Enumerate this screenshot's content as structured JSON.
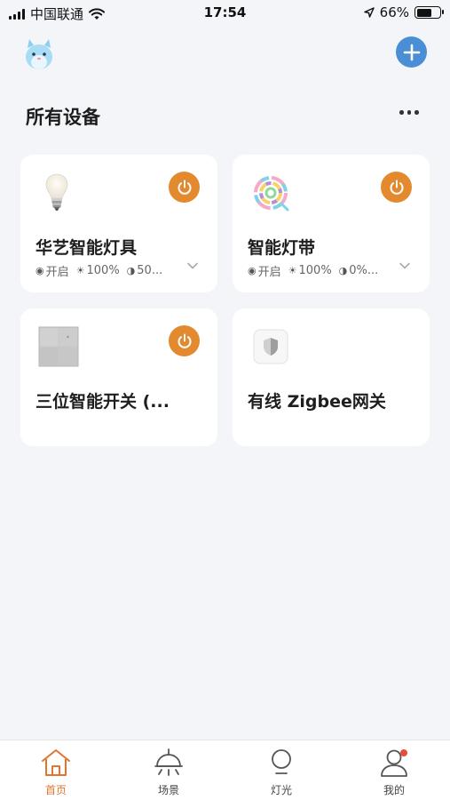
{
  "status_bar": {
    "carrier": "中国联通",
    "time": "17:54",
    "battery": "66%",
    "battery_level": 0.66
  },
  "header": {
    "title": "所有设备"
  },
  "devices": [
    {
      "name": "华艺智能灯具",
      "icon": "bulb-icon",
      "status": {
        "power": "开启",
        "brightness": "100%",
        "color_temp": "50..."
      },
      "has_power_button": true
    },
    {
      "name": "智能灯带",
      "icon": "light-strip-icon",
      "status": {
        "power": "开启",
        "brightness": "100%",
        "color_temp": "0%..."
      },
      "has_power_button": true
    },
    {
      "name": "三位智能开关 (...",
      "icon": "wall-switch-icon",
      "has_power_button": true
    },
    {
      "name": "有线 Zigbee网关",
      "icon": "gateway-shield-icon",
      "has_power_button": false
    }
  ],
  "tabs": [
    {
      "label": "首页",
      "icon": "home-icon",
      "active": true
    },
    {
      "label": "场景",
      "icon": "ceiling-lamp-icon",
      "active": false
    },
    {
      "label": "灯光",
      "icon": "bulb-outline-icon",
      "active": false
    },
    {
      "label": "我的",
      "icon": "person-icon",
      "active": false,
      "badge": true
    }
  ],
  "colors": {
    "accent_orange": "#e38a2f",
    "add_button_blue": "#4a8fd6",
    "active_tab": "#e2742f",
    "background": "#f3f5f9",
    "badge_red": "#e84b3c"
  }
}
